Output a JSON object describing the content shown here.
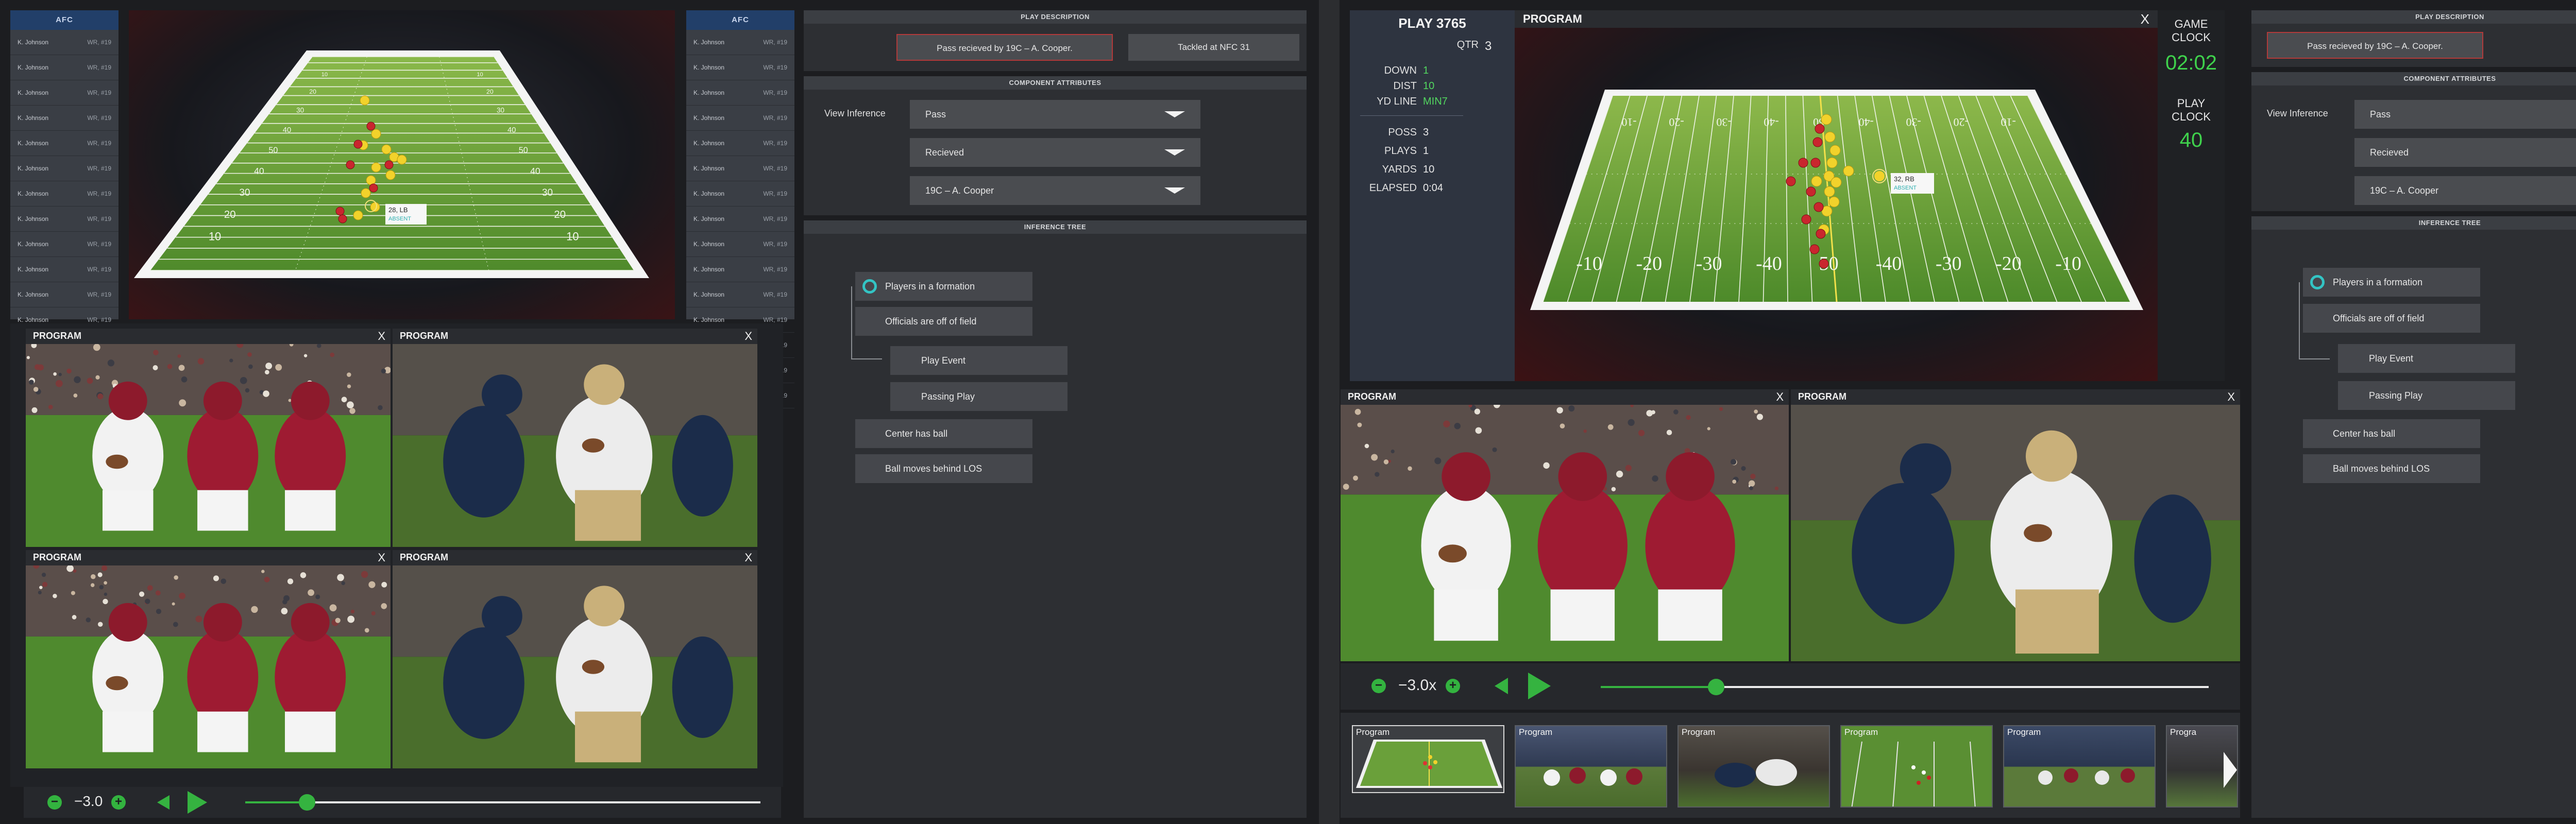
{
  "roster_left": {
    "header": "AFC",
    "rows": [
      {
        "name": "K. Johnson",
        "pos": "WR, #19"
      },
      {
        "name": "K. Johnson",
        "pos": "WR, #19"
      },
      {
        "name": "K. Johnson",
        "pos": "WR, #19"
      },
      {
        "name": "K. Johnson",
        "pos": "WR, #19"
      },
      {
        "name": "K. Johnson",
        "pos": "WR, #19"
      },
      {
        "name": "K. Johnson",
        "pos": "WR, #19"
      },
      {
        "name": "K. Johnson",
        "pos": "WR, #19"
      },
      {
        "name": "K. Johnson",
        "pos": "WR, #19"
      },
      {
        "name": "K. Johnson",
        "pos": "WR, #19"
      },
      {
        "name": "K. Johnson",
        "pos": "WR, #19"
      },
      {
        "name": "K. Johnson",
        "pos": "WR, #19"
      },
      {
        "name": "K. Johnson",
        "pos": "WR, #19"
      },
      {
        "name": "K. Johnson",
        "pos": "WR, #19"
      },
      {
        "name": "K. Johnson",
        "pos": "WR, #19"
      },
      {
        "name": "K. Johnson",
        "pos": "WR, #19"
      }
    ]
  },
  "roster_right": {
    "header": "AFC",
    "rows": [
      {
        "name": "K. Johnson",
        "pos": "WR, #19"
      },
      {
        "name": "K. Johnson",
        "pos": "WR, #19"
      },
      {
        "name": "K. Johnson",
        "pos": "WR, #19"
      },
      {
        "name": "K. Johnson",
        "pos": "WR, #19"
      },
      {
        "name": "K. Johnson",
        "pos": "WR, #19"
      },
      {
        "name": "K. Johnson",
        "pos": "WR, #19"
      },
      {
        "name": "K. Johnson",
        "pos": "WR, #19"
      },
      {
        "name": "K. Johnson",
        "pos": "WR, #19"
      },
      {
        "name": "K. Johnson",
        "pos": "WR, #19"
      },
      {
        "name": "K. Johnson",
        "pos": "WR, #19"
      },
      {
        "name": "K. Johnson",
        "pos": "WR, #19"
      },
      {
        "name": "K. Johnson",
        "pos": "WR, #19"
      },
      {
        "name": "K. Johnson",
        "pos": "WR, #19"
      },
      {
        "name": "K. Johnson",
        "pos": "WR, #19"
      },
      {
        "name": "K. Johnson",
        "pos": "WR, #19"
      }
    ]
  },
  "field_a": {
    "player_tag": "28, LB",
    "player_sub": "ABSENT",
    "player_sub2": "",
    "yard_labels": [
      "10",
      "20",
      "30",
      "40",
      "50",
      "40",
      "30",
      "20",
      "10"
    ]
  },
  "field_b": {
    "player_tag": "32, RB",
    "player_sub": "ABSENT",
    "player_sub2": "",
    "yard_labels": [
      "-10",
      "-20",
      "-30",
      "-40",
      "50",
      "-40",
      "-30",
      "-20",
      "-10"
    ],
    "yard_labels_top": [
      "-10",
      "-20",
      "-30",
      "-40",
      "50",
      "-40",
      "-30",
      "-20",
      "-10"
    ]
  },
  "play_description": {
    "title": "PLAY DESCRIPTION",
    "event1": "Pass recieved by 19C – A. Cooper.",
    "event2": "Tackled at NFC 31",
    "event1_b": "Pass recieved by 19C – A. Cooper."
  },
  "component_attributes": {
    "title": "COMPONENT ATTRIBUTES",
    "view_label": "View Inference",
    "select1": "Pass",
    "select2": "Recieved",
    "select3": "19C – A. Cooper"
  },
  "inference_tree": {
    "title": "INFERENCE TREE",
    "nodes": [
      "Players in a formation",
      "Officials are off of field",
      "Play Event",
      "Passing Play",
      "Center has ball",
      "Ball moves behind LOS"
    ]
  },
  "tiles": {
    "label": "PROGRAM",
    "close": "X"
  },
  "controls": {
    "minus": "−",
    "plus": "+",
    "speed_a": "−3.0",
    "speed_b": "−3.0x",
    "progress_a": 0.12,
    "progress_b": 0.19
  },
  "play_stats": {
    "play_label": "PLAY 3765",
    "qtr_label": "QTR",
    "qtr_value": "3",
    "down_label": "DOWN",
    "down_value": "1",
    "dist_label": "DIST",
    "dist_value": "10",
    "ydline_label": "YD LINE",
    "ydline_value": "MIN7",
    "poss_label": "POSS",
    "poss_value": "3",
    "plays_label": "PLAYS",
    "plays_value": "1",
    "yards_label": "YARDS",
    "yards_value": "10",
    "elapsed_label": "ELAPSED",
    "elapsed_value": "0:04"
  },
  "clocks": {
    "game_label_1": "GAME",
    "game_label_2": "CLOCK",
    "game_value": "02:02",
    "play_label_1": "PLAY",
    "play_label_2": "CLOCK",
    "play_value": "40"
  },
  "program_panel": {
    "title": "PROGRAM",
    "close": "X"
  },
  "thumbnails": [
    "Program",
    "Program",
    "Program",
    "Program",
    "Program",
    "Progra"
  ],
  "colors": {
    "accent_green": "#35b340",
    "alabama_red": "#9e1b32",
    "saints_gold": "#c9b07a",
    "seahawks_navy": "#1b2c4a",
    "turf": "#4c8c2a",
    "cyan": "#33c4c4"
  }
}
